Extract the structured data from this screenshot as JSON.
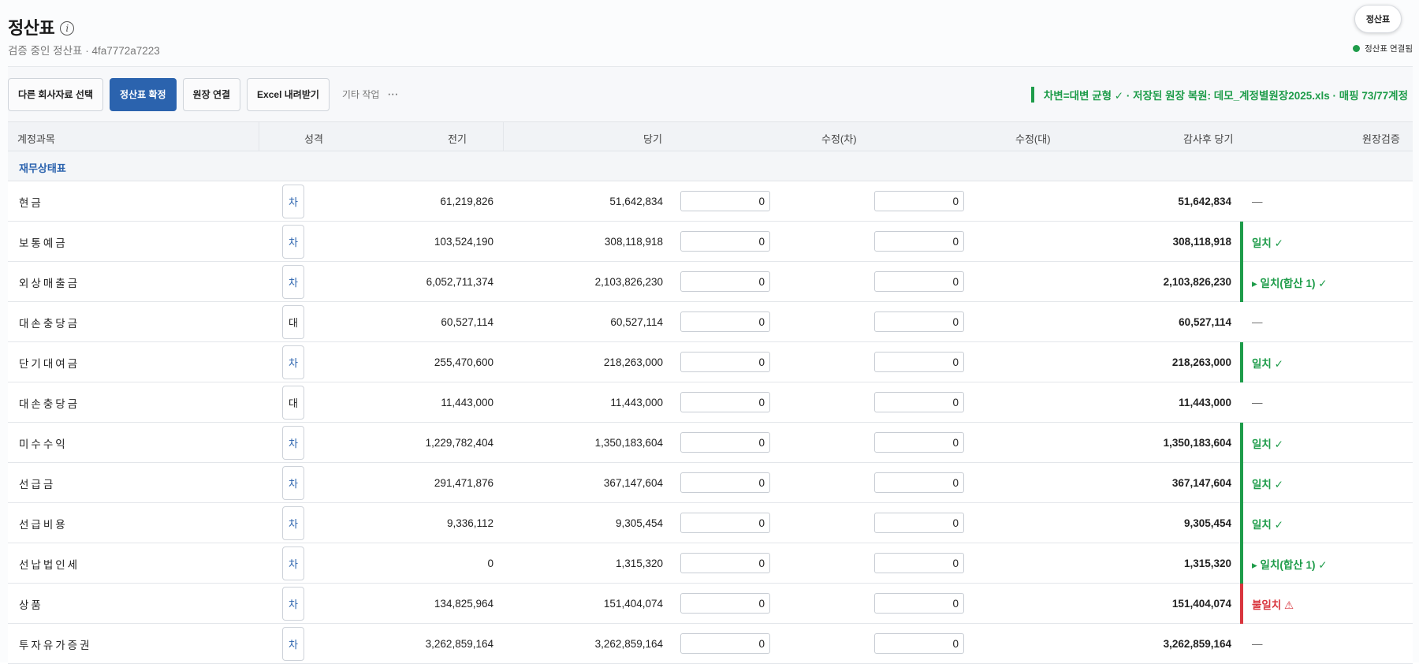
{
  "header": {
    "title": "정산표",
    "subtitle": "검증 중인 정산표 · 4fa7772a7223",
    "top_button": "정산표",
    "connection": "정산표 연결됨"
  },
  "toolbar": {
    "buttons": [
      "다른 회사자료 선택",
      "정산표 확정",
      "원장 연결",
      "Excel 내려받기"
    ],
    "more_label": "기타 작업",
    "more_icon": "⋯",
    "status": "차변=대변 균형 ✓ · 저장된 원장 복원: 데모_계정별원장2025.xls · 매핑 73/77계정"
  },
  "table": {
    "columns": [
      "계정과목",
      "성격",
      "전기",
      "당기",
      "수정(차)",
      "수정(대)",
      "감사후 당기",
      "원장검증"
    ],
    "section": "재무상태표",
    "rows": [
      {
        "name": "현금",
        "type": "차",
        "prev": "61,219,826",
        "cur": "51,642,834",
        "adj_dr": "0",
        "adj_cr": "0",
        "after": "51,642,834",
        "verify": "—",
        "status": "none"
      },
      {
        "name": "보통예금",
        "type": "차",
        "prev": "103,524,190",
        "cur": "308,118,918",
        "adj_dr": "0",
        "adj_cr": "0",
        "after": "308,118,918",
        "verify": "일치 ✓",
        "status": "ok"
      },
      {
        "name": "외상매출금",
        "type": "차",
        "prev": "6,052,711,374",
        "cur": "2,103,826,230",
        "adj_dr": "0",
        "adj_cr": "0",
        "after": "2,103,826,230",
        "verify": "▸ 일치(합산 1) ✓",
        "status": "ok"
      },
      {
        "name": "대손충당금",
        "type": "대",
        "prev": "60,527,114",
        "cur": "60,527,114",
        "adj_dr": "0",
        "adj_cr": "0",
        "after": "60,527,114",
        "verify": "—",
        "status": "none"
      },
      {
        "name": "단기대여금",
        "type": "차",
        "prev": "255,470,600",
        "cur": "218,263,000",
        "adj_dr": "0",
        "adj_cr": "0",
        "after": "218,263,000",
        "verify": "일치 ✓",
        "status": "ok"
      },
      {
        "name": "대손충당금",
        "type": "대",
        "prev": "11,443,000",
        "cur": "11,443,000",
        "adj_dr": "0",
        "adj_cr": "0",
        "after": "11,443,000",
        "verify": "—",
        "status": "none"
      },
      {
        "name": "미수수익",
        "type": "차",
        "prev": "1,229,782,404",
        "cur": "1,350,183,604",
        "adj_dr": "0",
        "adj_cr": "0",
        "after": "1,350,183,604",
        "verify": "일치 ✓",
        "status": "ok"
      },
      {
        "name": "선급금",
        "type": "차",
        "prev": "291,471,876",
        "cur": "367,147,604",
        "adj_dr": "0",
        "adj_cr": "0",
        "after": "367,147,604",
        "verify": "일치 ✓",
        "status": "ok"
      },
      {
        "name": "선급비용",
        "type": "차",
        "prev": "9,336,112",
        "cur": "9,305,454",
        "adj_dr": "0",
        "adj_cr": "0",
        "after": "9,305,454",
        "verify": "일치 ✓",
        "status": "ok"
      },
      {
        "name": "선납법인세",
        "type": "차",
        "prev": "0",
        "cur": "1,315,320",
        "adj_dr": "0",
        "adj_cr": "0",
        "after": "1,315,320",
        "verify": "▸ 일치(합산 1) ✓",
        "status": "ok"
      },
      {
        "name": "상품",
        "type": "차",
        "prev": "134,825,964",
        "cur": "151,404,074",
        "adj_dr": "0",
        "adj_cr": "0",
        "after": "151,404,074",
        "verify": "불일치 ⚠",
        "status": "bad"
      },
      {
        "name": "투자유가증권",
        "type": "차",
        "prev": "3,262,859,164",
        "cur": "3,262,859,164",
        "adj_dr": "0",
        "adj_cr": "0",
        "after": "3,262,859,164",
        "verify": "—",
        "status": "none"
      }
    ]
  },
  "colors": {
    "primary": "#2b63ae",
    "ok": "#1e9c4a",
    "bad": "#d9363e"
  }
}
